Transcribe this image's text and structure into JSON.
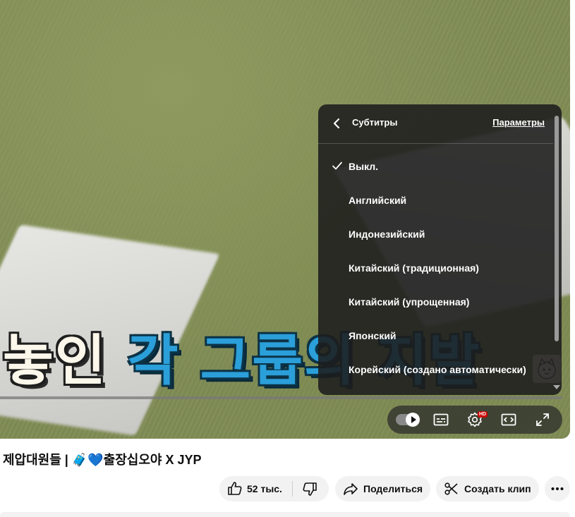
{
  "video": {
    "caption_white": "놓인 ",
    "caption_blue": "각 그룹의 지발"
  },
  "subtitles_menu": {
    "title": "Субтитры",
    "params_label": "Параметры",
    "selected_index": 0,
    "items": [
      {
        "label": "Выкл."
      },
      {
        "label": "Английский"
      },
      {
        "label": "Индонезийский"
      },
      {
        "label": "Китайский (традиционная)"
      },
      {
        "label": "Китайский (упрощенная)"
      },
      {
        "label": "Японский"
      },
      {
        "label": "Корейский (создано автоматически)"
      }
    ]
  },
  "player_controls": {
    "autoplay_on": true,
    "quality_badge": "HD"
  },
  "title": "제압대원들 | 🧳💙출장십오야 X JYP",
  "actions": {
    "like_count": "52 тыс.",
    "share_label": "Поделиться",
    "clip_label": "Создать клип"
  }
}
